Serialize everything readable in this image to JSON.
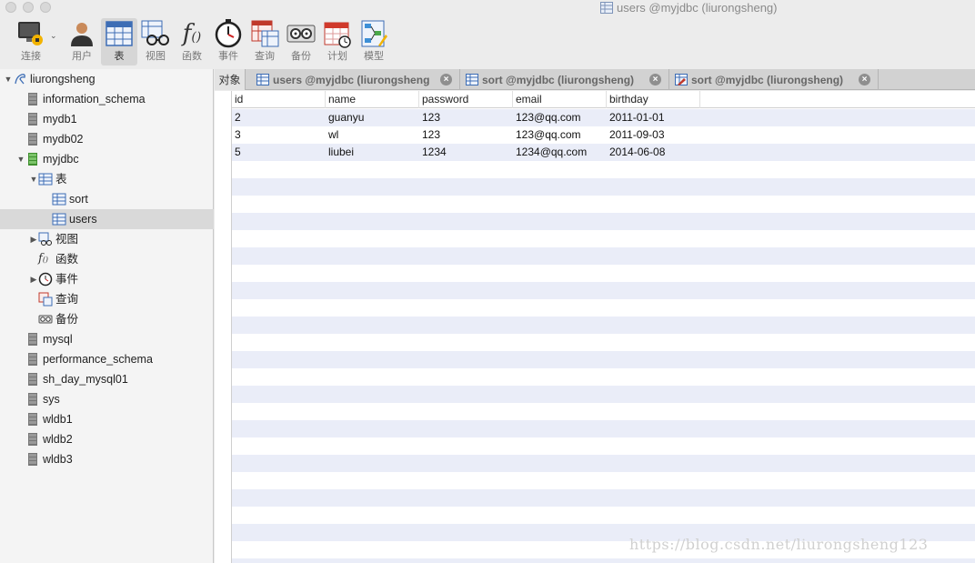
{
  "window": {
    "title": "users @myjdbc (liurongsheng)"
  },
  "toolbar": {
    "items": [
      {
        "label": "连接",
        "icon": "connection-icon"
      },
      {
        "label": "用户",
        "icon": "user-icon"
      },
      {
        "label": "表",
        "icon": "table-icon",
        "active": true
      },
      {
        "label": "视图",
        "icon": "view-icon"
      },
      {
        "label": "函数",
        "icon": "function-icon"
      },
      {
        "label": "事件",
        "icon": "event-icon"
      },
      {
        "label": "查询",
        "icon": "query-icon"
      },
      {
        "label": "备份",
        "icon": "backup-icon"
      },
      {
        "label": "计划",
        "icon": "schedule-icon"
      },
      {
        "label": "模型",
        "icon": "model-icon"
      }
    ]
  },
  "sidebar": {
    "connection": "liurongsheng",
    "databases_before": [
      "information_schema",
      "mydb1",
      "mydb02"
    ],
    "open_db": "myjdbc",
    "tables_group": "表",
    "tables": [
      "sort",
      "users"
    ],
    "selected_table": "users",
    "subgroups": [
      "视图",
      "函数",
      "事件",
      "查询",
      "备份"
    ],
    "databases_after": [
      "mysql",
      "performance_schema",
      "sh_day_mysql01",
      "sys",
      "wldb1",
      "wldb2",
      "wldb3"
    ]
  },
  "tabs": {
    "object_tab": "对象",
    "items": [
      {
        "label": "users @myjdbc (liurongsheng",
        "icon": "table-icon"
      },
      {
        "label": "sort @myjdbc (liurongsheng)",
        "icon": "table-icon"
      },
      {
        "label": "sort @myjdbc (liurongsheng)",
        "icon": "table-design-icon"
      }
    ]
  },
  "grid": {
    "columns": [
      "id",
      "name",
      "password",
      "email",
      "birthday"
    ],
    "rows": [
      [
        "2",
        "guanyu",
        "123",
        "123@qq.com",
        "2011-01-01"
      ],
      [
        "3",
        "wl",
        "123",
        "123@qq.com",
        "2011-09-03"
      ],
      [
        "5",
        "liubei",
        "1234",
        "1234@qq.com",
        "2014-06-08"
      ]
    ]
  },
  "watermark": "https://blog.csdn.net/liurongsheng123",
  "colors": {
    "row_stripe": "#eaedf8",
    "sidebar_selected": "#d9d9d9"
  }
}
